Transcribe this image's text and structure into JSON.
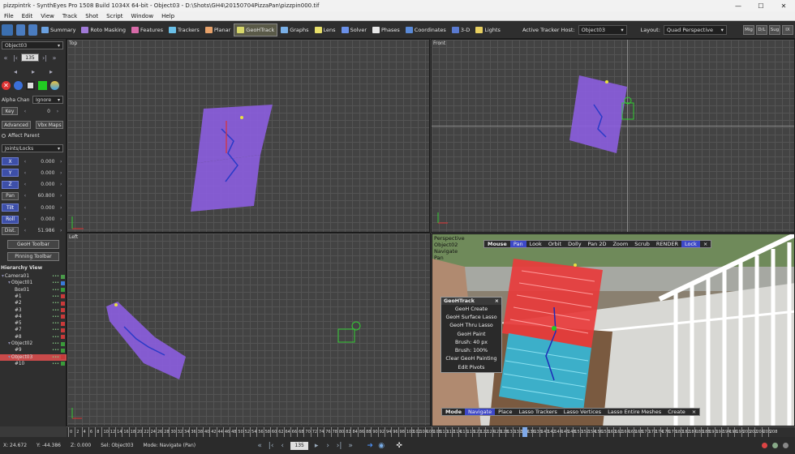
{
  "window": {
    "title": "pizzpintrk - SynthEyes Pro 1508 Build 1034X 64-bit - Object03 - D:\\Shots\\GH4\\20150704PizzaPan\\pizzpin000.tif",
    "min": "—",
    "max": "☐",
    "close": "✕"
  },
  "menu": [
    "File",
    "Edit",
    "View",
    "Track",
    "Shot",
    "Script",
    "Window",
    "Help"
  ],
  "toolbar": {
    "rooms": [
      {
        "label": "Summary",
        "color": "#6aa0e0"
      },
      {
        "label": "Roto Masking",
        "color": "#a07ad8"
      },
      {
        "label": "Features",
        "color": "#d86aa8"
      },
      {
        "label": "Trackers",
        "color": "#6ac0e8"
      },
      {
        "label": "Planar",
        "color": "#e8a26a"
      },
      {
        "label": "GeoHTrack",
        "color": "#d8d86a",
        "active": true
      },
      {
        "label": "Graphs",
        "color": "#7ab0e8"
      },
      {
        "label": "Lens",
        "color": "#e8e06a"
      },
      {
        "label": "Solver",
        "color": "#6a90e8"
      },
      {
        "label": "Phases",
        "color": "#e8e8e8"
      },
      {
        "label": "Coordinates",
        "color": "#5a8ad8"
      },
      {
        "label": "3-D",
        "color": "#5a7ad0"
      },
      {
        "label": "Lights",
        "color": "#e8d060"
      }
    ],
    "tracker_host_label": "Active Tracker Host:",
    "tracker_host_value": "Object03",
    "layout_label": "Layout:",
    "layout_value": "Quad Perspective",
    "right_buttons": [
      "Mig",
      "D/L",
      "Sug",
      "IX"
    ]
  },
  "left": {
    "object_select": "Object03",
    "frame": "135",
    "alpha_label": "Alpha Chan",
    "alpha_value": "Ignore",
    "key_label": "Key",
    "key_value": "0",
    "advanced": "Advanced",
    "vbx": "Vbx Maps",
    "affect_parent": "Affect Parent",
    "joints": "Joints/Locks",
    "params": [
      {
        "label": "X",
        "value": "0.000",
        "blue": true
      },
      {
        "label": "Y",
        "value": "0.000",
        "blue": true
      },
      {
        "label": "Z",
        "value": "0.000",
        "blue": true
      },
      {
        "label": "Pan",
        "value": "60.800",
        "blue": false
      },
      {
        "label": "Tilt",
        "value": "0.000",
        "blue": true
      },
      {
        "label": "Roll",
        "value": "0.000",
        "blue": true
      },
      {
        "label": "Dist.",
        "value": "51.986",
        "blue": false
      }
    ],
    "geoh_toolbar": "GeoH Toolbar",
    "pinning_toolbar": "Pinning Toolbar",
    "hierarchy_title": "Hierarchy View",
    "hierarchy": [
      {
        "name": "Camera01",
        "indent": 0,
        "tri": true,
        "color": "#4a9a4a"
      },
      {
        "name": "Object01",
        "indent": 1,
        "tri": true,
        "color": "#3a7ad8"
      },
      {
        "name": "Box01",
        "indent": 2,
        "tri": false,
        "color": "#3a9a3a"
      },
      {
        "name": "#1",
        "indent": 2,
        "tri": false,
        "color": "#c83a3a"
      },
      {
        "name": "#2",
        "indent": 2,
        "tri": false,
        "color": "#c83a3a"
      },
      {
        "name": "#3",
        "indent": 2,
        "tri": false,
        "color": "#c83a3a"
      },
      {
        "name": "#4",
        "indent": 2,
        "tri": false,
        "color": "#c83a3a"
      },
      {
        "name": "#5",
        "indent": 2,
        "tri": false,
        "color": "#c83a3a"
      },
      {
        "name": "#7",
        "indent": 2,
        "tri": false,
        "color": "#c83a3a"
      },
      {
        "name": "#8",
        "indent": 2,
        "tri": false,
        "color": "#c83a3a"
      },
      {
        "name": "Object02",
        "indent": 1,
        "tri": true,
        "color": "#3a9a3a"
      },
      {
        "name": "#9",
        "indent": 2,
        "tri": false,
        "color": "#3a9a3a"
      },
      {
        "name": "Object03",
        "indent": 1,
        "tri": true,
        "color": "#c83a3a",
        "selected": true
      },
      {
        "name": "#10",
        "indent": 2,
        "tri": false,
        "color": "#3a9a3a"
      }
    ]
  },
  "viewports": {
    "top": "Top",
    "front": "Front",
    "left": "Left",
    "persp_lines": [
      "Perspective",
      "Object02",
      "Navigate",
      "Pan"
    ]
  },
  "persp_menu_top": [
    "Mouse",
    "Pan",
    "Look",
    "Orbit",
    "Dolly",
    "Pan 2D",
    "Zoom",
    "Scrub",
    "RENDER",
    "Lock"
  ],
  "persp_menu_bottom": [
    "Mode",
    "Navigate",
    "Place",
    "Lasso Trackers",
    "Lasso Vertices",
    "Lasso Entire Meshes",
    "Create"
  ],
  "geoh_panel": {
    "title": "GeoHTrack",
    "items": [
      "GeoH Create",
      "GeoH Surface Lasso",
      "GeoH Thru Lasso",
      "GeoH Paint",
      "Brush: 40 px",
      "Brush: 100%",
      "Clear GeoH Painting",
      "Edit Pivots"
    ]
  },
  "timeline": {
    "ticks": [
      "0",
      "2",
      "4",
      "6",
      "8",
      "10",
      "12",
      "14",
      "16",
      "18",
      "20",
      "22",
      "24",
      "26",
      "28",
      "30",
      "32",
      "34",
      "36",
      "38",
      "40",
      "42",
      "44",
      "46",
      "48",
      "50",
      "52",
      "54",
      "56",
      "58",
      "60",
      "62",
      "64",
      "66",
      "68",
      "70",
      "72",
      "74",
      "76",
      "78",
      "80",
      "82",
      "84",
      "86",
      "88",
      "90",
      "92",
      "94",
      "96",
      "98",
      "100",
      "102",
      "104",
      "106",
      "108",
      "110",
      "112",
      "114",
      "116",
      "118",
      "120",
      "122",
      "124",
      "126",
      "128",
      "130",
      "132",
      "134",
      "136",
      "138",
      "140",
      "142",
      "144",
      "146",
      "148",
      "150",
      "152",
      "154",
      "156",
      "158",
      "160",
      "162",
      "164",
      "166",
      "168",
      "170",
      "172",
      "174",
      "176",
      "178",
      "180",
      "182",
      "184",
      "186",
      "188",
      "190",
      "192",
      "194",
      "196",
      "198",
      "200",
      "202",
      "204",
      "206",
      "208"
    ],
    "current": 135
  },
  "status": {
    "x": "X:  24.672",
    "y": "Y:  -44.386",
    "z": "Z:  0.000",
    "sel": "Sel: Object03",
    "mode": "Mode: Navigate (Pan)",
    "frame": "135"
  }
}
